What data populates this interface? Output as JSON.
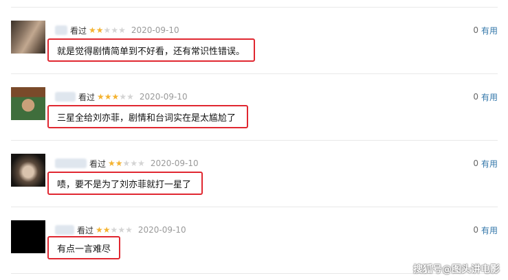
{
  "comments": [
    {
      "status": "看过",
      "rating": 2,
      "date": "2020-09-10",
      "votes": "0",
      "useful": "有用",
      "text": "就是觉得剧情简单到不好看，还有常识性错误。"
    },
    {
      "status": "看过",
      "rating": 3,
      "date": "2020-09-10",
      "votes": "0",
      "useful": "有用",
      "text": "三星全给刘亦菲，剧情和台词实在是太尴尬了"
    },
    {
      "status": "看过",
      "rating": 2,
      "date": "2020-09-10",
      "votes": "0",
      "useful": "有用",
      "text": "啧，要不是为了刘亦菲就打一星了"
    },
    {
      "status": "看过",
      "rating": 2,
      "date": "2020-09-10",
      "votes": "0",
      "useful": "有用",
      "text": "有点一言难尽"
    }
  ],
  "rating_max": 5,
  "watermark": "搜狐号@图头讲电影",
  "colors": {
    "highlight_border": "#e0262f",
    "star_on": "#f4b331",
    "star_off": "#d4d4d4",
    "link": "#3377aa"
  }
}
